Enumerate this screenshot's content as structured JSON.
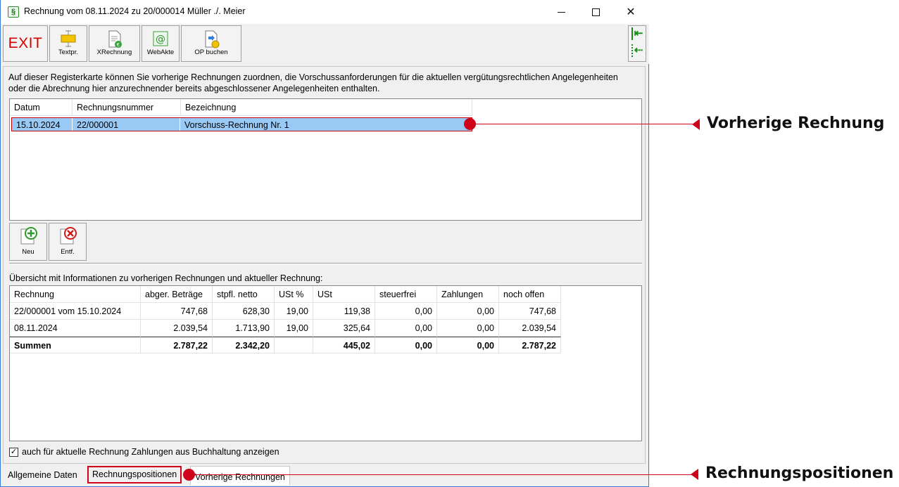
{
  "window": {
    "title": "Rechnung vom 08.11.2024 zu 20/000014  Müller ./. Meier",
    "app_icon_glyph": "§",
    "close_glyph": "✕"
  },
  "toolbar": {
    "exit_label": "EXIT",
    "textpr_label": "Textpr.",
    "xrechnung_label": "XRechnung",
    "webakte_label": "WebAkte",
    "op_buchen_label": "OP buchen"
  },
  "nav": {
    "arrow1": "⇤",
    "arrow2": "⇠"
  },
  "intro_text": "Auf dieser Registerkarte können Sie vorherige Rechnungen zuordnen, die Vorschussanforderungen für die aktuellen vergütungsrechtlichen Angelegenheiten oder die Abrechnung hier anzurechnender bereits abgeschlossener Angelegenheiten enthalten.",
  "prev_invoices": {
    "columns": [
      "Datum",
      "Rechnungsnummer",
      "Bezeichnung"
    ],
    "rows": [
      {
        "datum": "15.10.2024",
        "nummer": "22/000001",
        "bezeichnung": "Vorschuss-Rechnung Nr. 1"
      }
    ]
  },
  "buttons": {
    "neu_label": "Neu",
    "entf_label": "Entf."
  },
  "overview": {
    "label": "Übersicht mit Informationen zu vorherigen Rechnungen und aktueller Rechnung:",
    "columns": [
      "Rechnung",
      "abger. Beträge",
      "stpfl. netto",
      "USt %",
      "USt",
      "steuerfrei",
      "Zahlungen",
      "noch offen"
    ],
    "rows": [
      [
        "22/000001 vom 15.10.2024",
        "747,68",
        "628,30",
        "19,00",
        "119,38",
        "0,00",
        "0,00",
        "747,68"
      ],
      [
        "08.11.2024",
        "2.039,54",
        "1.713,90",
        "19,00",
        "325,64",
        "0,00",
        "0,00",
        "2.039,54"
      ],
      [
        "Summen",
        "2.787,22",
        "2.342,20",
        "",
        "445,02",
        "0,00",
        "0,00",
        "2.787,22"
      ]
    ]
  },
  "checkbox": {
    "label": "auch für aktuelle Rechnung Zahlungen aus Buchhaltung anzeigen",
    "checked_glyph": "✓"
  },
  "tabs": [
    "Allgemeine Daten",
    "Rechnungspositionen",
    "Vorherige Rechnungen"
  ],
  "callouts": {
    "vorherige": "Vorherige Rechnung",
    "positionen": "Rechnungspositionen",
    "color": "#d0021b"
  }
}
